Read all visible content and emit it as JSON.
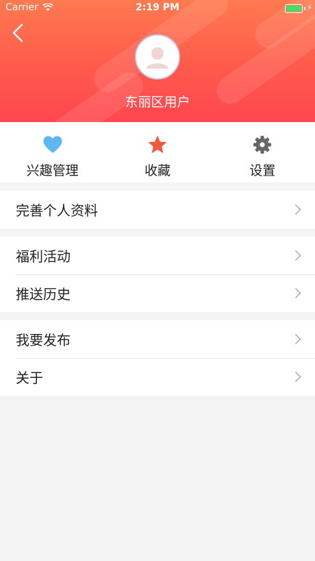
{
  "status_bar": {
    "carrier": "Carrier",
    "time": "2:19 PM"
  },
  "profile": {
    "username": "东丽区用户"
  },
  "quick_actions": [
    {
      "label": "兴趣管理",
      "icon": "heart-icon",
      "color": "#5bb8f0"
    },
    {
      "label": "收藏",
      "icon": "star-icon",
      "color": "#f05a3c"
    },
    {
      "label": "设置",
      "icon": "gear-icon",
      "color": "#666666"
    }
  ],
  "menu": {
    "group1": [
      {
        "label": "完善个人资料"
      }
    ],
    "group2": [
      {
        "label": "福利活动"
      },
      {
        "label": "推送历史"
      }
    ],
    "group3": [
      {
        "label": "我要发布"
      },
      {
        "label": "关于"
      }
    ]
  },
  "colors": {
    "header_top": "#ff7a4f",
    "header_bottom": "#ff4650",
    "battery": "#4cd964"
  }
}
